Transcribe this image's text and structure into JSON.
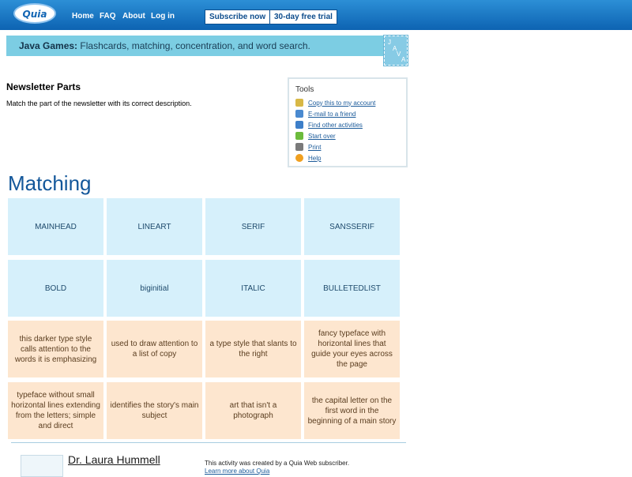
{
  "nav": {
    "logo": "Quia",
    "links": [
      "Home",
      "FAQ",
      "About",
      "Log in"
    ],
    "subscribe": "Subscribe now",
    "trial": "30-day free trial"
  },
  "banner": {
    "bold": "Java Games:",
    "text": " Flashcards, matching, concentration, and word search.",
    "badge": [
      "J",
      "A",
      "V",
      "A"
    ]
  },
  "activity": {
    "title": "Newsletter Parts",
    "description": "Match the part of the newsletter with its correct description."
  },
  "tools": {
    "title": "Tools",
    "items": [
      {
        "label": "Copy this to my account",
        "icon": "copy-icon",
        "color": "#d8b846"
      },
      {
        "label": "E-mail to a friend",
        "icon": "email-icon",
        "color": "#4a8ad0"
      },
      {
        "label": "Find other activities",
        "icon": "search-icon",
        "color": "#3d7fc9"
      },
      {
        "label": "Start over",
        "icon": "rewind-icon",
        "color": "#6cbb3c"
      },
      {
        "label": "Print",
        "icon": "print-icon",
        "color": "#7a7a7a"
      },
      {
        "label": "Help",
        "icon": "help-icon",
        "color": "#f0a020"
      }
    ]
  },
  "matching": {
    "heading": "Matching",
    "terms": [
      "MAINHEAD",
      "LINEART",
      "SERIF",
      "SANSSERIF",
      "BOLD",
      "biginitial",
      "ITALIC",
      "BULLETEDLIST"
    ],
    "definitions": [
      "this darker type style calls attention to the words it is emphasizing",
      "used to draw attention to a list of copy",
      "a type style that slants to the right",
      "fancy typeface with horizontal lines that guide your eyes across the page",
      "typeface without small horizontal lines extending from the letters; simple and direct",
      "identifies the story's main subject",
      "art that isn't a photograph",
      "the capital letter on the first word in the beginning of a main story"
    ]
  },
  "footer": {
    "author": "Dr. Laura Hummell",
    "note": "This activity was created by a Quia Web subscriber.",
    "link": "Learn more about Quia"
  }
}
